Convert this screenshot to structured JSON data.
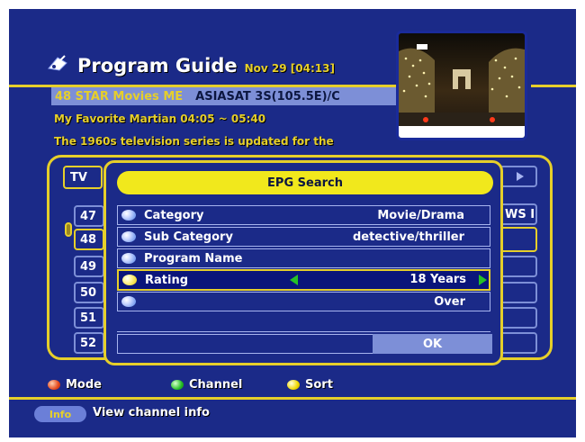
{
  "header": {
    "title": "Program Guide",
    "date": "Nov 29 [04:13]"
  },
  "channel_info": {
    "channel": "48  STAR Movies ME",
    "satellite": "ASIASAT 3S(105.5E)/C",
    "program": "My Favorite Martian  04:05 ~ 05:40",
    "description": "The 1960s television series is updated for the"
  },
  "background_list": {
    "tab": "TV",
    "rows": [
      "47",
      "48",
      "49",
      "50",
      "51",
      "52"
    ],
    "right_header": "WS I",
    "right_rows": [
      "",
      "",
      "",
      "",
      "",
      ""
    ]
  },
  "dialog": {
    "title": "EPG Search",
    "rows": [
      {
        "label": "Category",
        "value": "Movie/Drama"
      },
      {
        "label": "Sub Category",
        "value": "detective/thriller"
      },
      {
        "label": "Program Name",
        "value": ""
      },
      {
        "label": "Rating",
        "value": "18 Years"
      },
      {
        "label": "",
        "value": "Over"
      }
    ],
    "ok": "OK"
  },
  "legend": [
    {
      "label": "Mode",
      "color": "#e64a1e"
    },
    {
      "label": "Channel",
      "color": "#26c026"
    },
    {
      "label": "Sort",
      "color": "#f1d800"
    }
  ],
  "footer": {
    "key": "Info",
    "text": "View channel info"
  },
  "colors": {
    "background": "#1b2a88",
    "accent": "#e6cf2a",
    "highlight": "#7d8fd7"
  }
}
